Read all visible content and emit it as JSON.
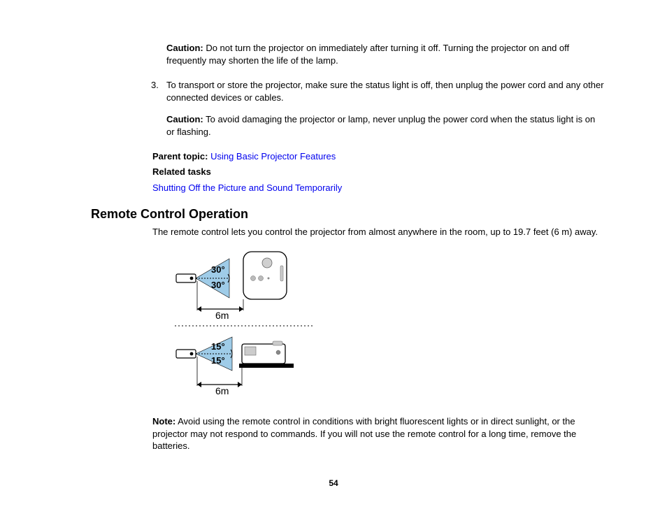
{
  "caution1_label": "Caution:",
  "caution1_text": " Do not turn the projector on immediately after turning it off. Turning the projector on and off frequently may shorten the life of the lamp.",
  "step3_num": "3.",
  "step3_text": "To transport or store the projector, make sure the status light is off, then unplug the power cord and any other connected devices or cables.",
  "caution2_label": "Caution:",
  "caution2_text": " To avoid damaging the projector or lamp, never unplug the power cord when the status light is on or flashing.",
  "parent_topic_label": "Parent topic: ",
  "parent_topic_link": "Using Basic Projector Features",
  "related_tasks_label": "Related tasks",
  "related_task_link": "Shutting Off the Picture and Sound Temporarily",
  "section_heading": "Remote Control Operation",
  "intro_text": "The remote control lets you control the projector from almost anywhere in the room, up to 19.7 feet (6 m) away.",
  "note_label": "Note:",
  "note_text": " Avoid using the remote control in conditions with bright fluorescent lights or in direct sunlight, or the projector may not respond to commands. If you will not use the remote control for a long time, remove the batteries.",
  "page_number": "54",
  "diagram": {
    "angle_top_upper": "30°",
    "angle_top_lower": "30°",
    "angle_bottom_upper": "15°",
    "angle_bottom_lower": "15°",
    "distance": "6m"
  }
}
